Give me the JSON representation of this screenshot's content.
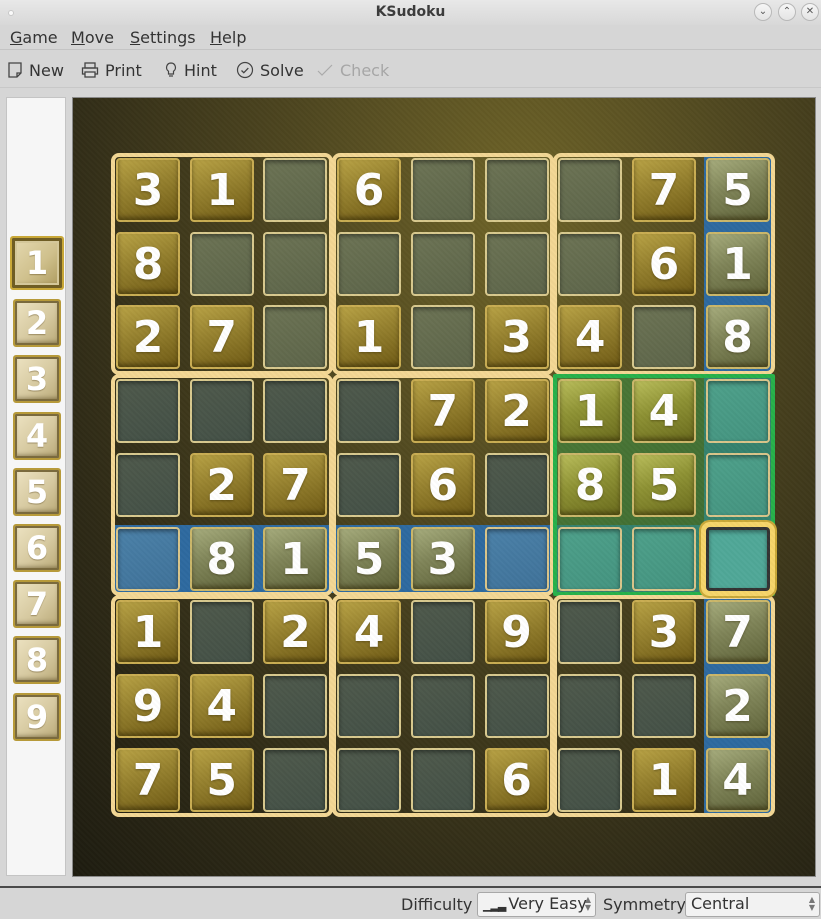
{
  "window": {
    "title": "KSudoku",
    "controls": [
      "minimize",
      "maximize",
      "close"
    ]
  },
  "menubar": {
    "items": [
      {
        "label": "Game",
        "mnemonic": "G"
      },
      {
        "label": "Move",
        "mnemonic": "M"
      },
      {
        "label": "Settings",
        "mnemonic": "S"
      },
      {
        "label": "Help",
        "mnemonic": "H"
      }
    ]
  },
  "toolbar": {
    "items": [
      {
        "label": "New",
        "icon": "new-document-icon",
        "enabled": true
      },
      {
        "label": "Print",
        "icon": "printer-icon",
        "enabled": true
      },
      {
        "label": "Hint",
        "icon": "lightbulb-icon",
        "enabled": true
      },
      {
        "label": "Solve",
        "icon": "check-circle-icon",
        "enabled": true
      },
      {
        "label": "Check",
        "icon": "checkmark-icon",
        "enabled": false
      }
    ]
  },
  "number_panel": {
    "numbers": [
      "1",
      "2",
      "3",
      "4",
      "5",
      "6",
      "7",
      "8",
      "9"
    ],
    "selected": "1"
  },
  "board": {
    "grid": [
      [
        "3",
        "1",
        "",
        "6",
        "",
        "",
        "",
        "7",
        "5"
      ],
      [
        "8",
        "",
        "",
        "",
        "",
        "",
        "",
        "6",
        "1"
      ],
      [
        "2",
        "7",
        "",
        "1",
        "",
        "3",
        "4",
        "",
        "8"
      ],
      [
        "",
        "",
        "",
        "",
        "7",
        "2",
        "1",
        "4",
        ""
      ],
      [
        "",
        "2",
        "7",
        "",
        "6",
        "",
        "8",
        "5",
        ""
      ],
      [
        "",
        "8",
        "1",
        "5",
        "3",
        "",
        "",
        "",
        ""
      ],
      [
        "1",
        "",
        "2",
        "4",
        "",
        "9",
        "",
        "3",
        "7"
      ],
      [
        "9",
        "4",
        "",
        "",
        "",
        "",
        "",
        "",
        "2"
      ],
      [
        "7",
        "5",
        "",
        "",
        "",
        "6",
        "",
        "1",
        "4"
      ]
    ],
    "selected_cell": {
      "row": 6,
      "col": 9
    },
    "highlight": {
      "row": 6,
      "col": 9,
      "box": 6
    },
    "colors": {
      "given": "#95802e",
      "empty": "#5d6549",
      "row_col_highlight": "#3f7299",
      "box_highlight": "#27b14a",
      "box_border": "#f3d794"
    }
  },
  "statusbar": {
    "difficulty_label": "Difficulty",
    "difficulty_value": "Very Easy",
    "symmetry_label": "Symmetry",
    "symmetry_value": "Central"
  }
}
